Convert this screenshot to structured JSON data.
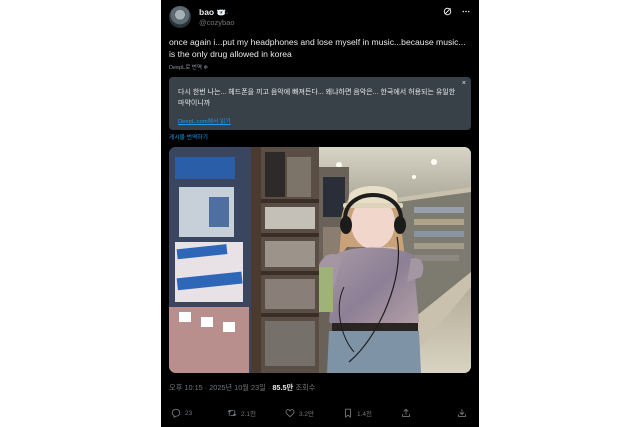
{
  "tweet": {
    "display_name": "bao",
    "name_emoji": "🐻‍❄️·",
    "handle": "@cozybao",
    "text": "once again i...put my headphones and lose myself in music...because music... is the only drug allowed in korea",
    "translate_small": "DeepL로 번역 ❄",
    "translation": {
      "text": "다시 한번 나는... 헤드폰을 끼고 음악에 빠져든다... 왜냐하면 음악은... 한국에서 허용되는 유일한 마약이니까",
      "link": "DeepL.com에서 읽기",
      "close": "×"
    },
    "translate_tweet": "게시물 번역하기",
    "time": "오후 10:15 · 2025년 10월 23일 ·",
    "views_count": "85.5만",
    "views_label": "조회수"
  },
  "header_icons": [
    "grok-icon",
    "more-icon"
  ],
  "actions": [
    {
      "icon": "reply-icon",
      "count": "23"
    },
    {
      "icon": "retweet-icon",
      "count": "2.1천"
    },
    {
      "icon": "like-icon",
      "count": "3.2만"
    },
    {
      "icon": "bookmark-icon",
      "count": "1.4천"
    },
    {
      "icon": "share-icon",
      "count": ""
    },
    {
      "icon": "download-icon",
      "count": ""
    }
  ],
  "colors": {
    "background": "#000000",
    "text": "#e7e9ea",
    "muted": "#71767b",
    "link": "#1d9bf0",
    "translation_box": "#384048"
  }
}
